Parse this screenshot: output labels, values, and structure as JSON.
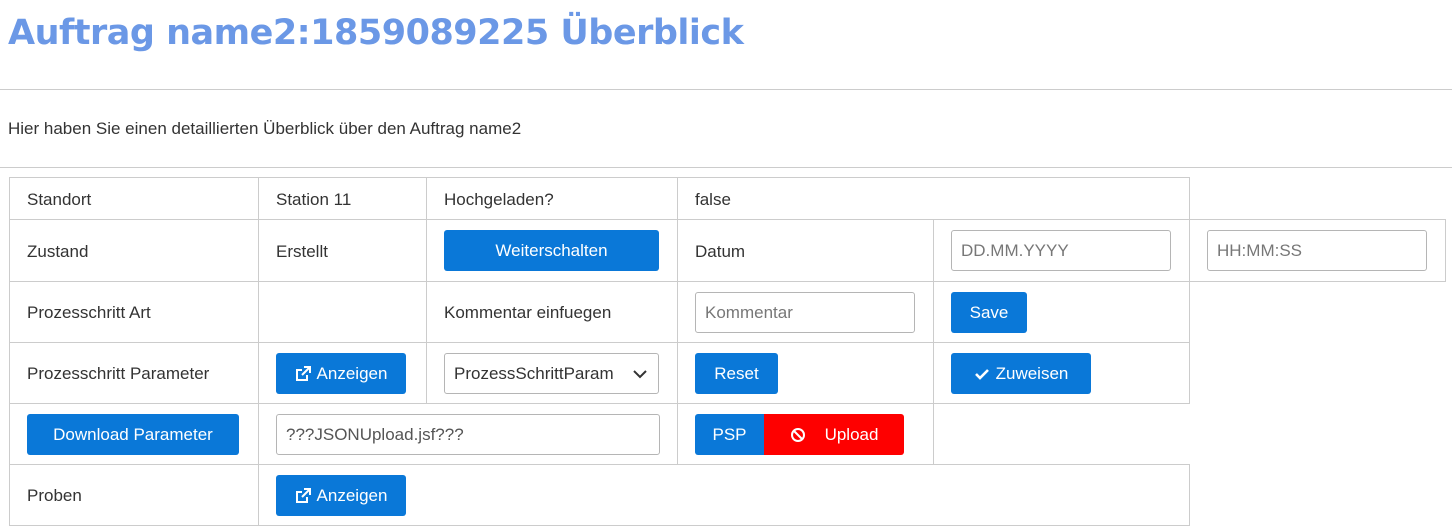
{
  "header": {
    "title": "Auftrag name2:1859089225 Überblick",
    "description": "Hier haben Sie einen detaillierten Überblick über den Auftrag name2"
  },
  "rows": {
    "standort": {
      "label": "Standort",
      "value": "Station 11",
      "uploaded_label": "Hochgeladen?",
      "uploaded_value": "false"
    },
    "zustand": {
      "label": "Zustand",
      "value": "Erstellt",
      "button_label": "Weiterschalten",
      "date_label": "Datum",
      "date_placeholder": "DD.MM.YYYY",
      "time_placeholder": "HH:MM:SS"
    },
    "prozessschritt_art": {
      "label": "Prozesschritt Art",
      "comment_label": "Kommentar einfuegen",
      "comment_placeholder": "Kommentar",
      "save_label": "Save"
    },
    "prozessschritt_parameter": {
      "label": "Prozesschritt Parameter",
      "show_label": "Anzeigen",
      "select_value": "ProzessSchrittParam",
      "reset_label": "Reset",
      "assign_label": "Zuweisen"
    },
    "parameter_actions": {
      "download_label": "Download Parameter",
      "file_value": "???JSONUpload.jsf???",
      "psp_label": "PSP",
      "upload_label": "Upload"
    },
    "proben": {
      "label": "Proben",
      "show_label": "Anzeigen"
    }
  },
  "icons": {
    "external_link": "external-link-icon",
    "check": "check-icon",
    "ban": "ban-icon",
    "chevron": "chevron-down-icon"
  },
  "colors": {
    "title": "#6b98e6",
    "primary": "#0a78d8",
    "danger": "#fe0000",
    "border": "#cccccc"
  }
}
